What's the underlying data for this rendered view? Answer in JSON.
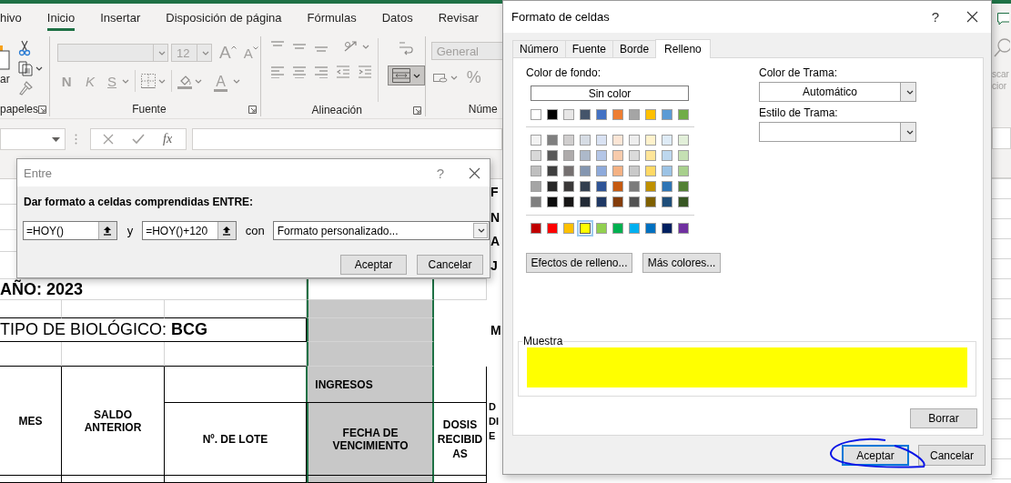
{
  "ribbon_tabs": [
    {
      "label": "hivo",
      "selected": false
    },
    {
      "label": "Inicio",
      "selected": true
    },
    {
      "label": "Insertar",
      "selected": false
    },
    {
      "label": "Disposición de página",
      "selected": false
    },
    {
      "label": "Fórmulas",
      "selected": false
    },
    {
      "label": "Datos",
      "selected": false
    },
    {
      "label": "Revisar",
      "selected": false
    }
  ],
  "ribbon": {
    "clipboard": {
      "paste_label": "ar",
      "group_label": "papeles"
    },
    "font": {
      "font_size": "12",
      "grow": "A",
      "shrink": "A",
      "bold": "N",
      "italic": "K",
      "underline": "S",
      "font_color": "A",
      "group_label": "Fuente"
    },
    "alignment": {
      "group_label": "Alineación"
    },
    "number": {
      "format": "General",
      "percent": "%",
      "group_label": "Núme"
    },
    "edge_texts": [
      "scar",
      "cior"
    ]
  },
  "formula_bar": {
    "function_button": "fx"
  },
  "sheet": {
    "title_fragments": [
      "F",
      "N",
      "A",
      "J"
    ],
    "year": "AÑO: 2023",
    "biologic": "TIPO DE BIOLÓGICO: **BCG**",
    "month_fragment": "M",
    "headers": {
      "month": "MES",
      "previous_balance": "SALDO ANTERIOR",
      "income": "INGRESOS",
      "lot": "Nº. DE LOTE",
      "expiry": "FECHA DE VENCIMIENTO",
      "received": "DOSIS RECIBIDAS"
    },
    "column_7_fragments": [
      "D",
      "DI",
      "E"
    ]
  },
  "between_dialog": {
    "title": "Entre",
    "help": "?",
    "prompt": "Dar formato a celdas comprendidas ENTRE:",
    "value_1": "=HOY()",
    "conjunction": "y",
    "value_2": "=HOY()+120",
    "with_label": "con",
    "format": "Formato personalizado...",
    "ok": "Aceptar",
    "cancel": "Cancelar"
  },
  "format_dialog": {
    "title": "Formato de celdas",
    "help": "?",
    "tabs": [
      {
        "label": "Número",
        "selected": false
      },
      {
        "label": "Fuente",
        "selected": false
      },
      {
        "label": "Borde",
        "selected": false
      },
      {
        "label": "Relleno",
        "selected": true
      }
    ],
    "background_label": "Color de fondo:",
    "no_color": "Sin color",
    "theme_colors": [
      {
        "color": "#ffffff",
        "selected": false
      },
      {
        "color": "#000000",
        "selected": false
      },
      {
        "color": "#e7e6e6",
        "selected": false
      },
      {
        "color": "#44546a",
        "selected": false
      },
      {
        "color": "#4472c4",
        "selected": false
      },
      {
        "color": "#ed7d31",
        "selected": false
      },
      {
        "color": "#a5a5a5",
        "selected": false
      },
      {
        "color": "#ffc000",
        "selected": false
      },
      {
        "color": "#5b9bd5",
        "selected": false
      },
      {
        "color": "#70ad47",
        "selected": false
      }
    ],
    "tint_rows": [
      {
        "swatches": [
          {
            "color": "#f2f2f2",
            "selected": false
          },
          {
            "color": "#7f7f7f",
            "selected": false
          },
          {
            "color": "#d0cece",
            "selected": false
          },
          {
            "color": "#d6dce4",
            "selected": false
          },
          {
            "color": "#d9e2f3",
            "selected": false
          },
          {
            "color": "#fbe5d5",
            "selected": false
          },
          {
            "color": "#ededed",
            "selected": false
          },
          {
            "color": "#fff2cc",
            "selected": false
          },
          {
            "color": "#deebf6",
            "selected": false
          },
          {
            "color": "#e2efd9",
            "selected": false
          }
        ]
      },
      {
        "swatches": [
          {
            "color": "#d8d8d8",
            "selected": false
          },
          {
            "color": "#595959",
            "selected": false
          },
          {
            "color": "#aeabab",
            "selected": false
          },
          {
            "color": "#adb9ca",
            "selected": false
          },
          {
            "color": "#b4c6e7",
            "selected": false
          },
          {
            "color": "#f7cbac",
            "selected": false
          },
          {
            "color": "#dbdbdb",
            "selected": false
          },
          {
            "color": "#fee599",
            "selected": false
          },
          {
            "color": "#bdd7ee",
            "selected": false
          },
          {
            "color": "#c5e0b3",
            "selected": false
          }
        ]
      },
      {
        "swatches": [
          {
            "color": "#bfbfbf",
            "selected": false
          },
          {
            "color": "#3f3f3f",
            "selected": false
          },
          {
            "color": "#757070",
            "selected": false
          },
          {
            "color": "#8496b0",
            "selected": false
          },
          {
            "color": "#8eaadb",
            "selected": false
          },
          {
            "color": "#f4b183",
            "selected": false
          },
          {
            "color": "#c9c9c9",
            "selected": false
          },
          {
            "color": "#ffd965",
            "selected": false
          },
          {
            "color": "#9cc3e5",
            "selected": false
          },
          {
            "color": "#a8d08d",
            "selected": false
          }
        ]
      },
      {
        "swatches": [
          {
            "color": "#a5a5a5",
            "selected": false
          },
          {
            "color": "#262626",
            "selected": false
          },
          {
            "color": "#3a3838",
            "selected": false
          },
          {
            "color": "#323f4f",
            "selected": false
          },
          {
            "color": "#2f5496",
            "selected": false
          },
          {
            "color": "#c55a11",
            "selected": false
          },
          {
            "color": "#7b7b7b",
            "selected": false
          },
          {
            "color": "#bf9000",
            "selected": false
          },
          {
            "color": "#2e75b5",
            "selected": false
          },
          {
            "color": "#538135",
            "selected": false
          }
        ]
      },
      {
        "swatches": [
          {
            "color": "#7f7f7f",
            "selected": false
          },
          {
            "color": "#0c0c0c",
            "selected": false
          },
          {
            "color": "#171616",
            "selected": false
          },
          {
            "color": "#222a35",
            "selected": false
          },
          {
            "color": "#1f3864",
            "selected": false
          },
          {
            "color": "#833c0b",
            "selected": false
          },
          {
            "color": "#525252",
            "selected": false
          },
          {
            "color": "#7f6000",
            "selected": false
          },
          {
            "color": "#1f4e79",
            "selected": false
          },
          {
            "color": "#375623",
            "selected": false
          }
        ]
      }
    ],
    "standard_colors": [
      {
        "color": "#c00000",
        "selected": false
      },
      {
        "color": "#ff0000",
        "selected": false
      },
      {
        "color": "#ffc000",
        "selected": false
      },
      {
        "color": "#ffff00",
        "selected": true
      },
      {
        "color": "#92d050",
        "selected": false
      },
      {
        "color": "#00b050",
        "selected": false
      },
      {
        "color": "#00b0f0",
        "selected": false
      },
      {
        "color": "#0070c0",
        "selected": false
      },
      {
        "color": "#002060",
        "selected": false
      },
      {
        "color": "#7030a0",
        "selected": false
      }
    ],
    "fill_effects": "Efectos de relleno...",
    "more_colors": "Más colores...",
    "pattern_color_label": "Color de Trama:",
    "pattern_color": "Automático",
    "pattern_style_label": "Estilo de Trama:",
    "sample_label": "Muestra",
    "clear": "Borrar",
    "ok": "Aceptar",
    "cancel": "Cancelar"
  },
  "annotation": {
    "kind": "circle"
  }
}
